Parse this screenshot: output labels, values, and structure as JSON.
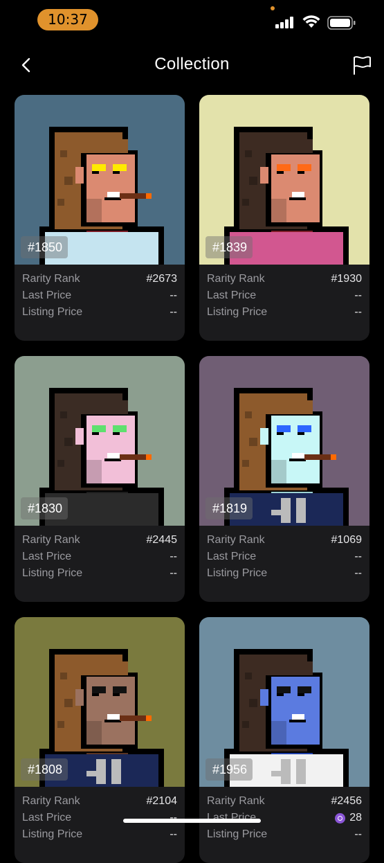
{
  "status_bar": {
    "time": "10:37",
    "accent": "#e0922c"
  },
  "header": {
    "title": "Collection",
    "back_icon": "chevron-left-icon",
    "flag_icon": "flag-icon"
  },
  "labels": {
    "rarity": "Rarity Rank",
    "last_price": "Last Price",
    "listing_price": "Listing Price"
  },
  "cards": [
    {
      "id": "#1850",
      "rarity": "#2673",
      "last_price": "--",
      "listing_price": "--",
      "bg": "#4b6c82",
      "skin": "#db8a71",
      "hair": "#8d5a2c",
      "eyes": "#ffeb00",
      "cigarette": true,
      "shirt": "#c5e4f0",
      "collar": "#7c1c26",
      "jersey": false
    },
    {
      "id": "#1839",
      "rarity": "#1930",
      "last_price": "--",
      "listing_price": "--",
      "bg": "#e3e2ab",
      "skin": "#db8a71",
      "hair": "#3d2b22",
      "eyes": "#ff6a17",
      "cigarette": false,
      "shirt": "#d25790",
      "collar": "#7c1c26",
      "jersey": false
    },
    {
      "id": "#1830",
      "rarity": "#2445",
      "last_price": "--",
      "listing_price": "--",
      "bg": "#8c9e8f",
      "skin": "#f2bfd8",
      "hair": "#3b2c24",
      "eyes": "#5ee06e",
      "cigarette": true,
      "shirt": "#2b2b2b",
      "collar": "#1c1c1c",
      "jersey": false
    },
    {
      "id": "#1819",
      "rarity": "#1069",
      "last_price": "--",
      "listing_price": "--",
      "bg": "#705e74",
      "skin": "#c8f7f7",
      "hair": "#8d5a2c",
      "eyes": "#2d66ff",
      "cigarette": true,
      "shirt": "#1b2857",
      "collar": "#9ed2d2",
      "jersey": true
    },
    {
      "id": "#1808",
      "rarity": "#2104",
      "last_price": "--",
      "listing_price": "--",
      "bg": "#7a7a3e",
      "skin": "#9b7260",
      "hair": "#8d5a2c",
      "eyes": "#111111",
      "cigarette": true,
      "shirt": "#1b2857",
      "collar": "#5a3422",
      "jersey": true
    },
    {
      "id": "#1956",
      "rarity": "#2456",
      "last_price": "28",
      "listing_price": "--",
      "bg": "#6e8da0",
      "skin": "#5b7be0",
      "hair": "#3d2b22",
      "eyes": "#111111",
      "cigarette": false,
      "shirt": "#f2f2f2",
      "collar": "#1f3fa8",
      "jersey": true,
      "last_price_icon": "exchange-token-icon"
    }
  ]
}
